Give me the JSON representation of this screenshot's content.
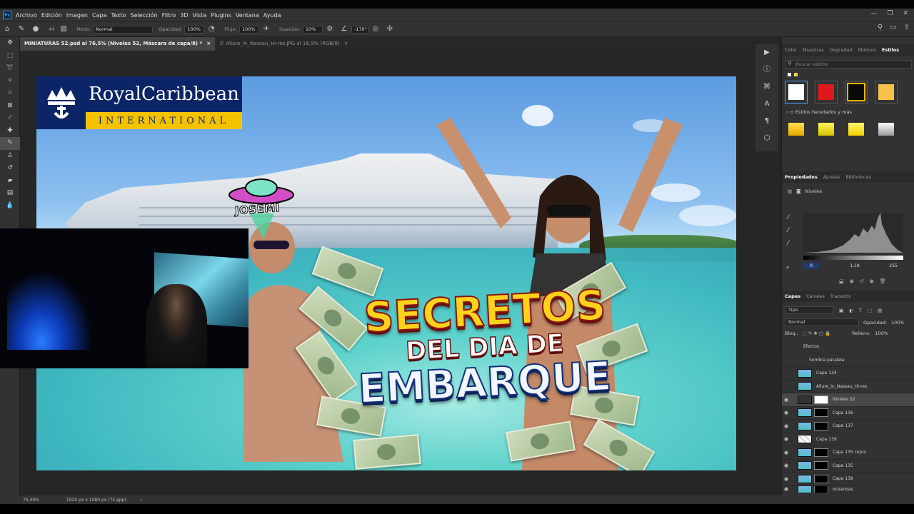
{
  "menubar": {
    "app_icon": "Ps",
    "items": [
      "Archivo",
      "Edición",
      "Imagen",
      "Capa",
      "Texto",
      "Selección",
      "Filtro",
      "3D",
      "Vista",
      "Plugins",
      "Ventana",
      "Ayuda"
    ]
  },
  "options": {
    "size": "44",
    "mode_label": "Modo:",
    "mode_value": "Normal",
    "opacity_label": "Opacidad:",
    "opacity_value": "100%",
    "flow_label": "Flujo:",
    "flow_value": "100%",
    "smooth_label": "Suavizar:",
    "smooth_value": "10%",
    "angle_value": "-170°"
  },
  "tabs": [
    {
      "label": "MINIATURAS 52.psd al 76,5% (Niveles 52, Máscara de capa/8) *",
      "close": "×"
    },
    {
      "label": "© Allure_in_Nassau_Hi-res.JPG al 16,9% (RGB/8)",
      "close": "×"
    }
  ],
  "thumbnail": {
    "brand_name": "RoyalCaribbean",
    "brand_sub": "INTERNATIONAL",
    "sticker": "JOSEMI",
    "title_line1": "SECRETOS",
    "title_line2": "DEL DIA DE",
    "title_line3": "EMBARQUE"
  },
  "status": {
    "zoom": "76,49%",
    "dimensions": "1920 px x 1080 px (72 ppp)"
  },
  "styles_panel": {
    "tabs": [
      "Color",
      "Muestras",
      "Degradad",
      "Motivos",
      "Estilos"
    ],
    "active_tab": "Estilos",
    "search_placeholder": "Buscar estilos",
    "swatches": [
      "#ffffff",
      "#e0181b",
      "#0a0a0a",
      "#f6c24a"
    ],
    "inherited_label": "Estilos heredados y más"
  },
  "properties_panel": {
    "tabs": [
      "Propiedades",
      "Ajustes",
      "Bibliotecas"
    ],
    "active_tab": "Propiedades",
    "adjustment_name": "Niveles",
    "input_low": "0",
    "input_mid": "1,18",
    "input_high": "255"
  },
  "layers_panel": {
    "tabs": [
      "Capas",
      "Canales",
      "Trazados"
    ],
    "active_tab": "Capas",
    "filter_label": "Tipo",
    "blend_mode": "Normal",
    "opacity_label": "Opacidad:",
    "opacity_value": "100%",
    "lock_label": "Bloq.:",
    "fill_label": "Relleno:",
    "fill_value": "100%",
    "layers": [
      {
        "name": "Efectos",
        "visible": false,
        "indent": true
      },
      {
        "name": "Sombra paralela",
        "visible": false,
        "indent": true
      },
      {
        "name": "Capa 134",
        "visible": false
      },
      {
        "name": "Allure_in_Nassau_Hi-res",
        "visible": false
      },
      {
        "name": "Niveles 52",
        "visible": true,
        "selected": true
      },
      {
        "name": "Capa 136",
        "visible": true
      },
      {
        "name": "Capa 137",
        "visible": true
      },
      {
        "name": "Capa 139",
        "visible": true
      },
      {
        "name": "Capa 135 copia",
        "visible": true
      },
      {
        "name": "Capa 135",
        "visible": true
      },
      {
        "name": "Capa 138",
        "visible": true
      },
      {
        "name": "oceanoas",
        "visible": true
      }
    ]
  }
}
